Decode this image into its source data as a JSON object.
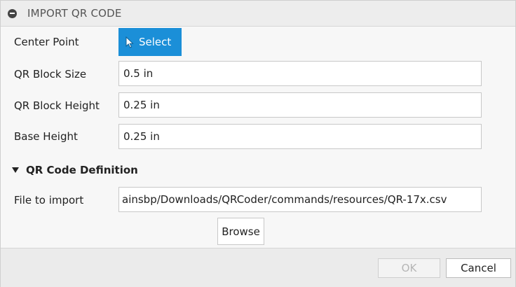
{
  "header": {
    "title": "IMPORT QR CODE",
    "collapse_icon": "minus-circle-icon"
  },
  "fields": {
    "center_point": {
      "label": "Center Point",
      "button_label": "Select",
      "button_icon": "cursor-arrow-icon",
      "accent": "#1b8fd8"
    },
    "block_size": {
      "label": "QR Block Size",
      "value": "0.5 in"
    },
    "block_height": {
      "label": "QR Block Height",
      "value": "0.25 in"
    },
    "base_height": {
      "label": "Base Height",
      "value": "0.25 in"
    }
  },
  "section": {
    "label": "QR Code Definition",
    "toggle_icon": "triangle-down-icon",
    "file_label": "File to import",
    "file_value": "ainsbp/Downloads/QRCoder/commands/resources/QR-17x.csv",
    "browse_label": "Browse"
  },
  "footer": {
    "ok_label": "OK",
    "cancel_label": "Cancel"
  }
}
